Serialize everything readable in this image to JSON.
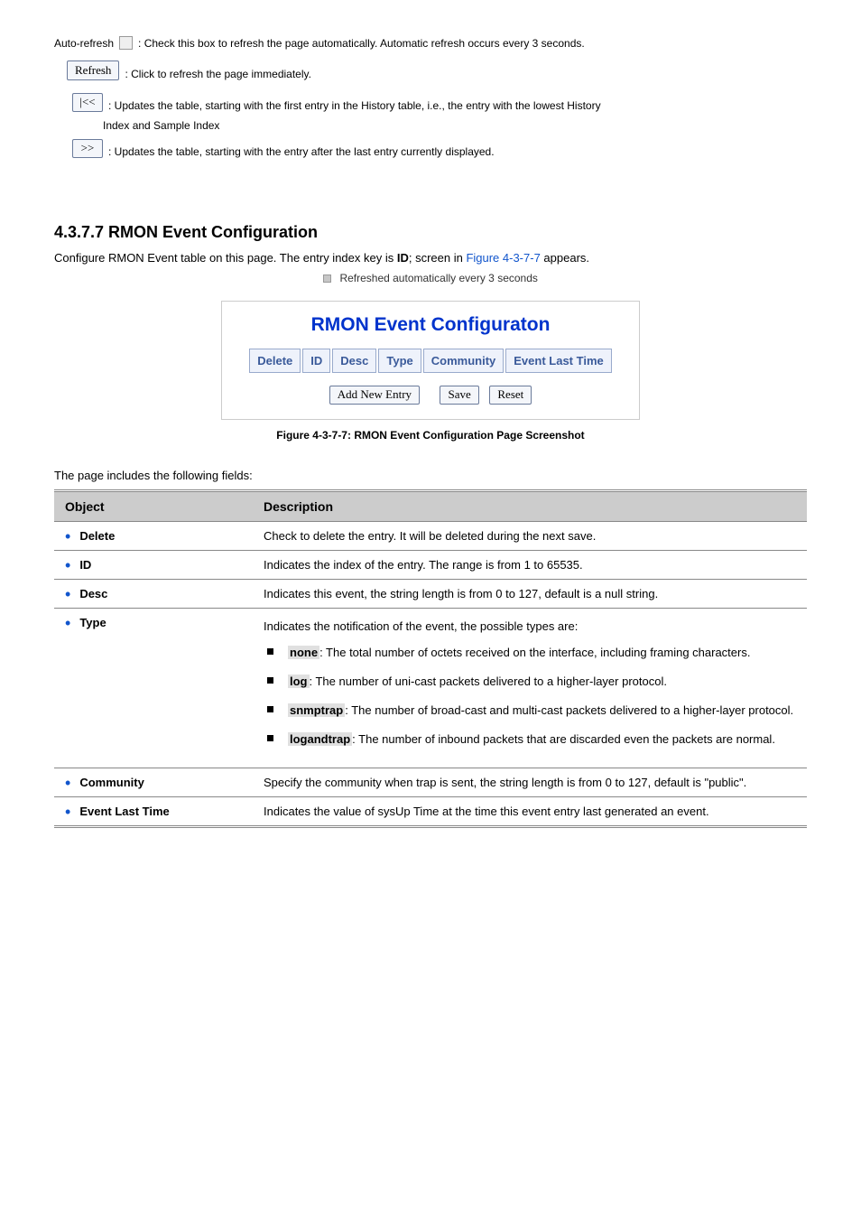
{
  "controls": {
    "auto_refresh_label": "Auto-refresh",
    "auto_refresh_after": ": Check this box to refresh the page automatically. Automatic refresh occurs every 3 seconds.",
    "refresh_label": "Refresh",
    "refresh_after": ": Click to refresh the page immediately.",
    "prev_after": ": Updates the table, starting with the first entry in the History table, i.e., the entry with the lowest History",
    "prev_line2": "Index and Sample Index",
    "next_after": ": Updates the table, starting with the entry after the last entry currently displayed."
  },
  "section": {
    "heading": "4.3.7.7 RMON Event Configuration",
    "intro_1": "Configure RMON Event table on this page. The entry index key is ",
    "intro_id": "ID",
    "intro_2": "; screen in ",
    "intro_fig": "Figure 4-3-7-7",
    "intro_3": " appears.",
    "pre_bullet": "Refreshed automatically every 3 seconds"
  },
  "panel": {
    "title": "RMON Event Configuraton",
    "headers": [
      "Delete",
      "ID",
      "Desc",
      "Type",
      "Community",
      "Event Last Time"
    ],
    "btn_add": "Add New Entry",
    "btn_save": "Save",
    "btn_reset": "Reset"
  },
  "caption": "Figure 4-3-7-7: RMON Event Configuration Page Screenshot",
  "table": {
    "intro": "The page includes the following fields:",
    "head_obj": "Object",
    "head_desc": "Description",
    "rows": [
      {
        "obj": "Delete",
        "desc": "Check to delete the entry. It will be deleted during the next save."
      },
      {
        "obj": "ID",
        "desc": "Indicates the index of the entry. The range is from 1 to 65535."
      },
      {
        "obj": "Desc",
        "desc": "Indicates this event, the string length is from 0 to 127, default is a null string."
      },
      {
        "obj": "Type",
        "desc_lead": "Indicates the notification of the event, the possible types are:",
        "subs": [
          {
            "key": "none",
            "text": ": The total number of octets received on the interface, including framing characters."
          },
          {
            "key": "log",
            "text": ": The number of uni-cast packets delivered to a higher-layer protocol."
          },
          {
            "key": "snmptrap",
            "text": ": The number of broad-cast and multi-cast packets delivered to a higher-layer protocol."
          },
          {
            "key": "logandtrap",
            "text": ": The number of inbound packets that are discarded even the packets are normal."
          }
        ]
      },
      {
        "obj": "Community",
        "desc": "Specify the community when trap is sent, the string length is from 0 to 127, default is \"public\"."
      },
      {
        "obj": "Event Last Time",
        "desc": "Indicates the value of sysUp Time at the time this event entry last generated an event."
      }
    ]
  }
}
